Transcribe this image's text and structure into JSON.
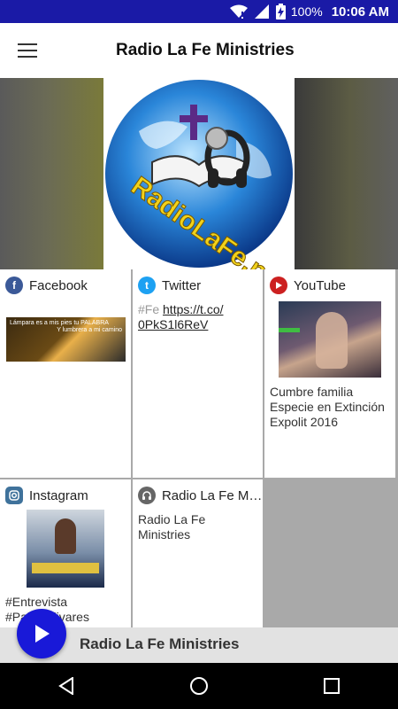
{
  "status": {
    "battery": "100%",
    "time": "10:06 AM"
  },
  "app": {
    "title": "Radio La Fe Ministries"
  },
  "logo": {
    "text": "RadioLaFe.net"
  },
  "cards": {
    "facebook": {
      "label": "Facebook",
      "image_text_1": "Lámpara es a mis pies tu PALABRA",
      "image_text_2": "Y lumbrera a mi camino"
    },
    "twitter": {
      "label": "Twitter",
      "hashtag": "#Fe",
      "link_1": "https://t.co/",
      "link_2": "0PkS1l6ReV"
    },
    "youtube": {
      "label": "YouTube",
      "text": "Cumbre familia Especie en Extinción Expolit 2016"
    },
    "instagram": {
      "label": "Instagram",
      "line1": "#Entrevista",
      "line2": "#PabloOlivares"
    },
    "radio": {
      "label": "Radio La Fe Mi...",
      "text": "Radio La Fe Ministries"
    }
  },
  "player": {
    "title": "Radio La Fe Ministries"
  },
  "colors": {
    "status_bar": "#1a1aa6",
    "play_button": "#1919d8",
    "facebook": "#3b5998",
    "twitter": "#1da1f2",
    "youtube": "#cc2020",
    "instagram": "#3f729b",
    "radio": "#666666"
  }
}
